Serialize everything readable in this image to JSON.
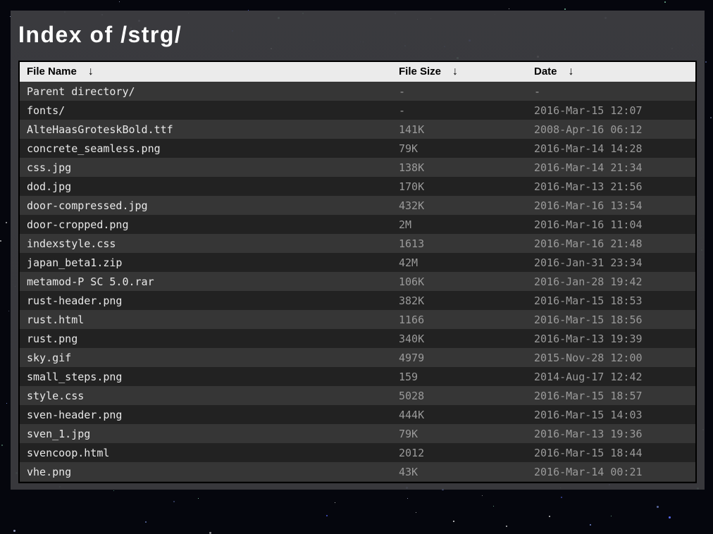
{
  "page": {
    "title": "Index of /strg/"
  },
  "listing": {
    "columns": [
      {
        "label": "File Name",
        "sort_icon": "↓"
      },
      {
        "label": "File Size",
        "sort_icon": "↓"
      },
      {
        "label": "Date",
        "sort_icon": "↓"
      }
    ],
    "rows": [
      {
        "name": "Parent directory/",
        "size": "-",
        "date": "-"
      },
      {
        "name": "fonts/",
        "size": "-",
        "date": "2016-Mar-15 12:07"
      },
      {
        "name": "AlteHaasGroteskBold.ttf",
        "size": "141K",
        "date": "2008-Apr-16 06:12"
      },
      {
        "name": "concrete_seamless.png",
        "size": "79K",
        "date": "2016-Mar-14 14:28"
      },
      {
        "name": "css.jpg",
        "size": "138K",
        "date": "2016-Mar-14 21:34"
      },
      {
        "name": "dod.jpg",
        "size": "170K",
        "date": "2016-Mar-13 21:56"
      },
      {
        "name": "door-compressed.jpg",
        "size": "432K",
        "date": "2016-Mar-16 13:54"
      },
      {
        "name": "door-cropped.png",
        "size": "2M",
        "date": "2016-Mar-16 11:04"
      },
      {
        "name": "indexstyle.css",
        "size": "1613",
        "date": "2016-Mar-16 21:48"
      },
      {
        "name": "japan_beta1.zip",
        "size": "42M",
        "date": "2016-Jan-31 23:34"
      },
      {
        "name": "metamod-P SC 5.0.rar",
        "size": "106K",
        "date": "2016-Jan-28 19:42"
      },
      {
        "name": "rust-header.png",
        "size": "382K",
        "date": "2016-Mar-15 18:53"
      },
      {
        "name": "rust.html",
        "size": "1166",
        "date": "2016-Mar-15 18:56"
      },
      {
        "name": "rust.png",
        "size": "340K",
        "date": "2016-Mar-13 19:39"
      },
      {
        "name": "sky.gif",
        "size": "4979",
        "date": "2015-Nov-28 12:00"
      },
      {
        "name": "small_steps.png",
        "size": "159",
        "date": "2014-Aug-17 12:42"
      },
      {
        "name": "style.css",
        "size": "5028",
        "date": "2016-Mar-15 18:57"
      },
      {
        "name": "sven-header.png",
        "size": "444K",
        "date": "2016-Mar-15 14:03"
      },
      {
        "name": "sven_1.jpg",
        "size": "79K",
        "date": "2016-Mar-13 19:36"
      },
      {
        "name": "svencoop.html",
        "size": "2012",
        "date": "2016-Mar-15 18:44"
      },
      {
        "name": "vhe.png",
        "size": "43K",
        "date": "2016-Mar-14 00:21"
      }
    ]
  },
  "colors": {
    "background": "#05060d",
    "panel": "#3e3e42",
    "header_row": "#ebebeb",
    "row_light": "#363636",
    "row_dark": "#222222",
    "name_text": "#e8e8e8",
    "meta_text": "#9a9a9a"
  }
}
